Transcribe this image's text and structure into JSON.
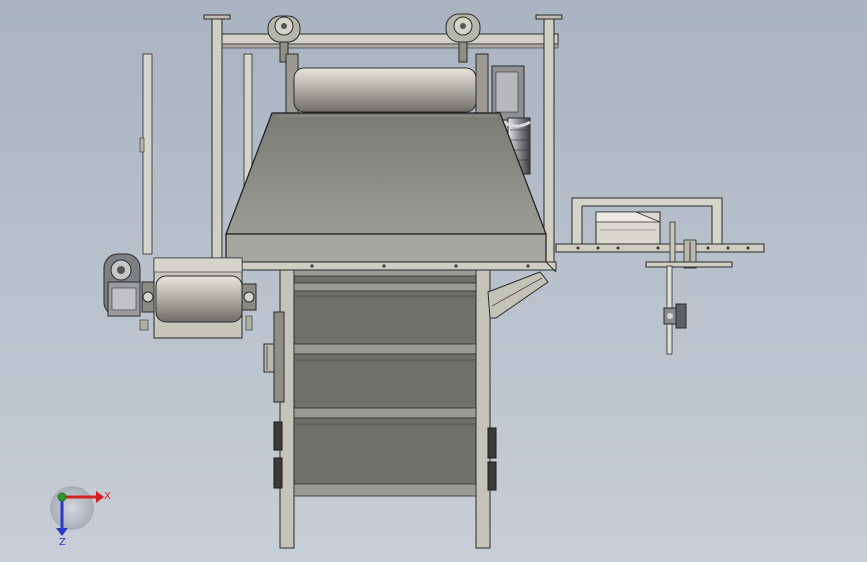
{
  "viewport": {
    "background_top": "#a9b4c1",
    "background_bottom": "#c7ced7"
  },
  "colors": {
    "metal": "#c9c8bd",
    "panel": "#8a8b82",
    "belt": "#6f7068",
    "edge": "#2a2a2a",
    "axis_x": "#d42020",
    "axis_y": "#2a9a2a",
    "axis_z": "#2a3ac8"
  },
  "triad": {
    "x_label": "X",
    "z_label": "Z"
  }
}
